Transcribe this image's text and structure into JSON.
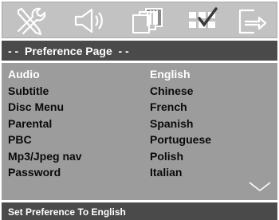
{
  "menu": {
    "page_title": "- -  Preference Page  - -",
    "icons": [
      "tools-icon",
      "speaker-icon",
      "video-screen-icon",
      "preference-icon",
      "exit-icon"
    ],
    "settings": [
      {
        "label": "Audio",
        "value": "English",
        "selected": true
      },
      {
        "label": "Subtitle",
        "value": "Chinese"
      },
      {
        "label": "Disc Menu",
        "value": "French"
      },
      {
        "label": "Parental",
        "value": "Spanish"
      },
      {
        "label": "PBC",
        "value": "Portuguese"
      },
      {
        "label": "Mp3/Jpeg nav",
        "value": "Polish"
      },
      {
        "label": "Password",
        "value": "Italian"
      }
    ],
    "status": "Set Preference To English"
  },
  "colors": {
    "icon_bar": "#c2c2c2",
    "title_bar": "#4a4a4a",
    "panel": "#9c9c9c",
    "selected_text": "#ffffff",
    "text": "#0a0a0a"
  }
}
